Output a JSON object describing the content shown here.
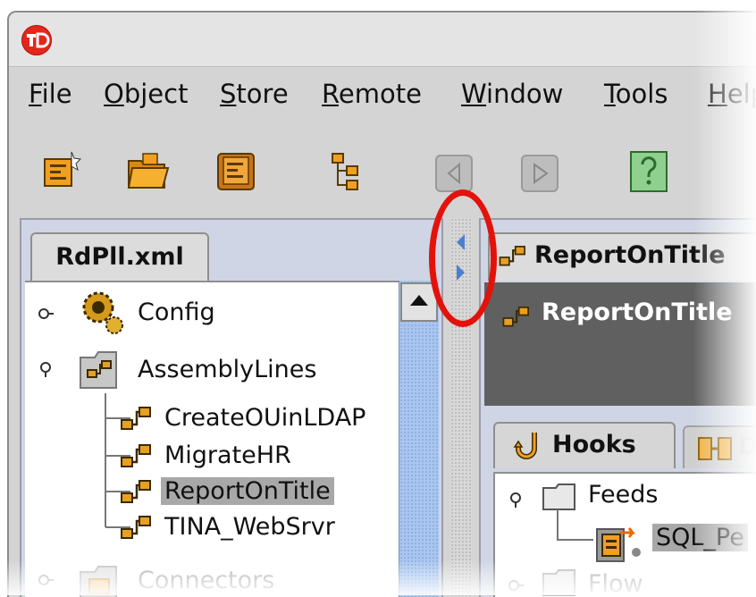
{
  "app": {
    "icon_label": "TDI"
  },
  "menu": {
    "items": [
      {
        "label": "File",
        "mnemonic": "F",
        "rest": "ile"
      },
      {
        "label": "Object",
        "mnemonic": "O",
        "rest": "bject"
      },
      {
        "label": "Store",
        "mnemonic": "S",
        "rest": "tore"
      },
      {
        "label": "Remote",
        "mnemonic": "R",
        "rest": "emote"
      },
      {
        "label": "Window",
        "mnemonic": "W",
        "rest": "indow"
      },
      {
        "label": "Tools",
        "mnemonic": "T",
        "rest": "ools"
      },
      {
        "label": "Help",
        "mnemonic": "H",
        "rest": "elp"
      }
    ]
  },
  "toolbar": {
    "buttons": [
      {
        "icon": "new-config-icon",
        "enabled": true
      },
      {
        "icon": "open-folder-icon",
        "enabled": true
      },
      {
        "icon": "save-config-icon",
        "enabled": true
      },
      {
        "icon": "tree-view-icon",
        "enabled": true
      },
      {
        "icon": "back-icon",
        "enabled": false
      },
      {
        "icon": "run-icon",
        "enabled": false
      },
      {
        "icon": "help-icon",
        "enabled": true
      }
    ]
  },
  "left_panel": {
    "tab_label": "RdPll.xml",
    "tree": {
      "config": "Config",
      "assembly_lines": "AssemblyLines",
      "items": [
        "CreateOUinLDAP",
        "MigrateHR",
        "ReportOnTitle",
        "TINA_WebSrvr"
      ],
      "selected": "ReportOnTitle",
      "connectors": "Connectors"
    }
  },
  "right_panel": {
    "tab_label": "ReportOnTitle",
    "header_title": "ReportOnTitle",
    "subtabs": [
      "Hooks",
      "D"
    ],
    "feeds_tree": {
      "feeds": "Feeds",
      "connector": "SQL_Pe",
      "flow": "Flow"
    }
  },
  "colors": {
    "highlight": "#e3120b",
    "selection": "#a8a8a8",
    "scrollbar": "#a9c6f0",
    "header_bg": "#606060"
  }
}
